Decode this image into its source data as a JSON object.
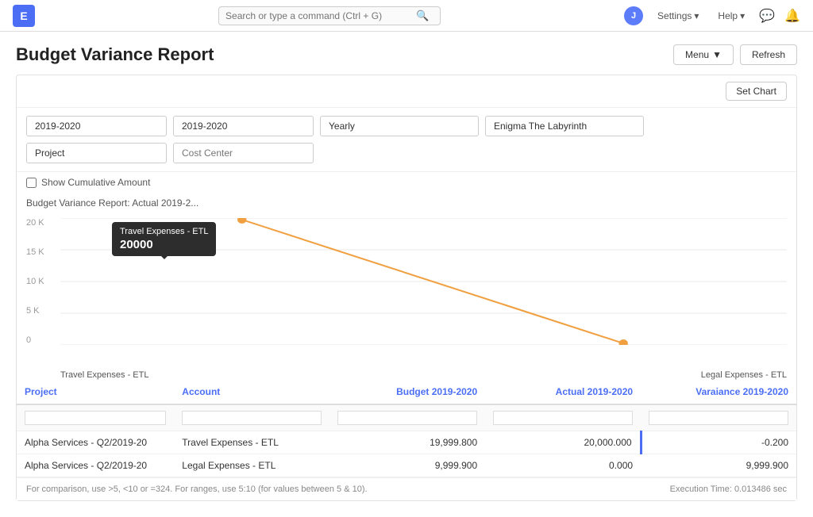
{
  "nav": {
    "logo": "E",
    "search_placeholder": "Search or type a command (Ctrl + G)",
    "user_initial": "J",
    "settings_label": "Settings",
    "help_label": "Help",
    "settings_arrow": "▾",
    "help_arrow": "▾"
  },
  "page": {
    "title": "Budget Variance Report",
    "menu_label": "Menu",
    "refresh_label": "Refresh",
    "set_chart_label": "Set Chart"
  },
  "filters": {
    "year_from": "2019-2020",
    "year_to": "2019-2020",
    "period": "Yearly",
    "company": "Enigma The Labyrinth",
    "project": "Project",
    "cost_center_placeholder": "Cost Center",
    "show_cumulative_label": "Show Cumulative Amount"
  },
  "chart": {
    "title": "Budget Variance Report: Actual 2019-2...",
    "y_labels": [
      "0",
      "5 K",
      "10 K",
      "15 K",
      "20 K"
    ],
    "x_labels": [
      "Travel Expenses - ETL",
      "Legal Expenses - ETL"
    ],
    "tooltip_title": "Travel Expenses - ETL",
    "tooltip_value": "20000",
    "line_color": "#f0a040",
    "dot_color": "#f0a040"
  },
  "table": {
    "columns": [
      "Project",
      "Account",
      "Budget 2019-2020",
      "Actual 2019-2020",
      "Varaiance 2019-2020"
    ],
    "rows": [
      {
        "project": "Alpha Services - Q2/2019-20",
        "account": "Travel Expenses - ETL",
        "budget": "19,999.800",
        "actual": "20,000.000",
        "variance": "-0.200",
        "variance_highlight": true
      },
      {
        "project": "Alpha Services - Q2/2019-20",
        "account": "Legal Expenses - ETL",
        "budget": "9,999.900",
        "actual": "0.000",
        "variance": "9,999.900",
        "variance_highlight": false
      }
    ]
  },
  "footer": {
    "hint": "For comparison, use >5, <10 or =324. For ranges, use 5:10 (for values between 5 & 10).",
    "execution": "Execution Time: 0.013486 sec"
  }
}
